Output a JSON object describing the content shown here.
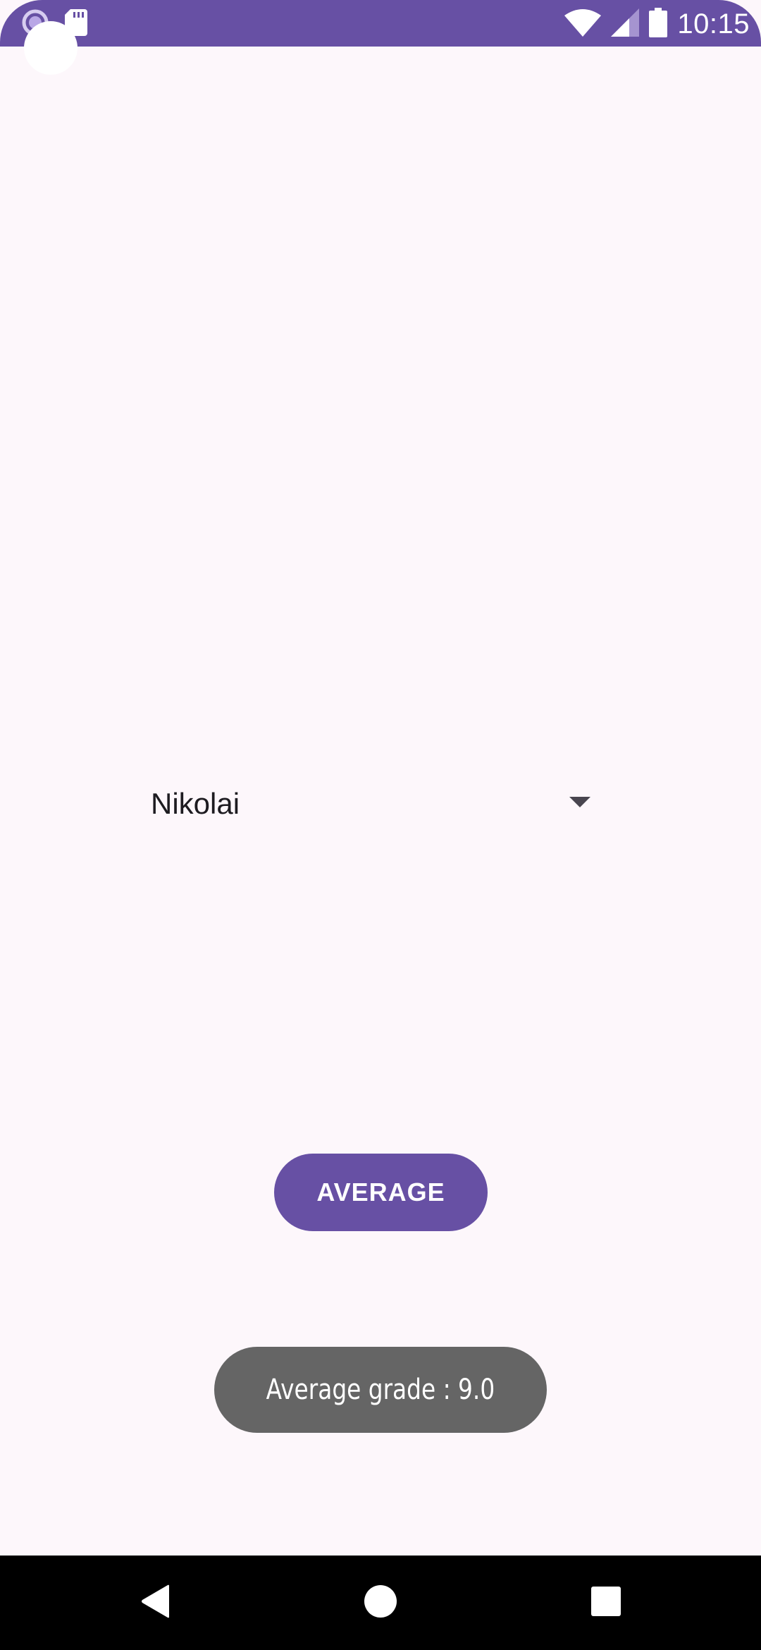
{
  "status_bar": {
    "time": "10:15",
    "left_icons": [
      "notification-circle-icon",
      "sd-card-icon"
    ],
    "right_icons": [
      "wifi-icon",
      "cell-signal-icon",
      "battery-icon"
    ],
    "color": "#6750a4"
  },
  "spinner": {
    "selected_value": "Nikolai"
  },
  "button": {
    "label": "AVERAGE",
    "color": "#6750a4"
  },
  "toast": {
    "message": "Average grade : 9.0"
  },
  "nav_bar": {
    "buttons": [
      "back-icon",
      "home-icon",
      "recents-icon"
    ]
  }
}
